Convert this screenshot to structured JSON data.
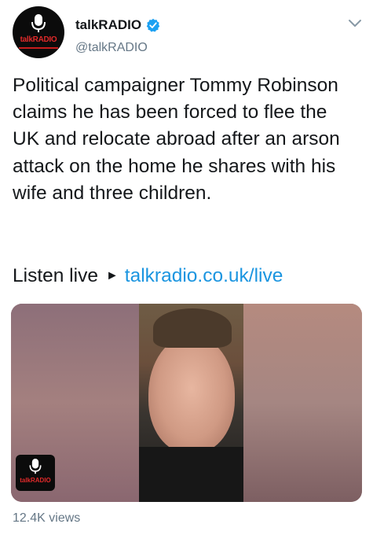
{
  "account": {
    "display_name": "talkRADIO",
    "handle": "@talkRADIO",
    "avatar_brand_text": "talkRADIO",
    "verified": true
  },
  "tweet": {
    "text": "Political campaigner Tommy Robinson claims he has been forced to flee the UK and relocate abroad after an arson attack on the home he shares with his wife and three children.",
    "listen_label": "Listen live",
    "arrow_glyph": "►",
    "link_text": "talkradio.co.uk/live"
  },
  "media": {
    "badge_text": "talkRADIO"
  },
  "stats": {
    "views": "12.4K views"
  },
  "colors": {
    "link": "#1b95e0",
    "verified_badge": "#1da1f2",
    "secondary_text": "#657786",
    "brand_red": "#e02a2a"
  },
  "icons": {
    "verified": "verified-check-icon",
    "menu": "chevron-down-icon",
    "microphone": "microphone-icon"
  }
}
